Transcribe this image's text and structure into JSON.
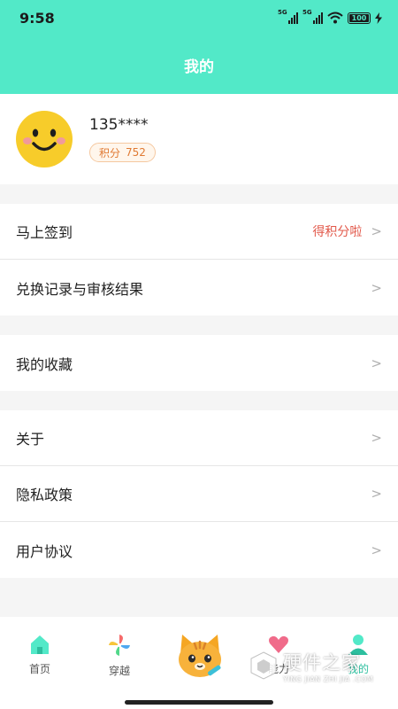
{
  "status_bar": {
    "time": "9:58",
    "network_1": "5G",
    "network_2": "5G",
    "battery_level": "100",
    "icons": [
      "signal-icon",
      "signal-icon",
      "wifi-icon",
      "battery-icon",
      "charging-icon"
    ]
  },
  "header": {
    "title": "我的"
  },
  "profile": {
    "username": "135****",
    "points_label": "积分",
    "points_value": "752",
    "avatar_icon": "smiley-face-icon"
  },
  "menu": {
    "checkin": {
      "label": "马上签到",
      "hint": "得积分啦"
    },
    "exchange": {
      "label": "兑换记录与审核结果"
    },
    "favorites": {
      "label": "我的收藏"
    },
    "about": {
      "label": "关于"
    },
    "privacy": {
      "label": "隐私政策"
    },
    "agreement": {
      "label": "用户协议"
    },
    "chevron": ">"
  },
  "tabbar": {
    "home": {
      "label": "首页",
      "icon": "home-icon"
    },
    "travel": {
      "label": "穿越",
      "icon": "pinwheel-icon"
    },
    "center": {
      "icon": "cat-mascot-icon"
    },
    "fourth": {
      "label": "能力",
      "icon": "heart-icon"
    },
    "mine": {
      "label": "我的",
      "icon": "person-icon"
    },
    "active": "mine"
  },
  "watermark": {
    "cn": "硬件之家",
    "en": "YING JIAN ZHI JIA .COM"
  },
  "colors": {
    "brand": "#52e9c8",
    "accent": "#e2584a",
    "badge": "#e07a33"
  }
}
